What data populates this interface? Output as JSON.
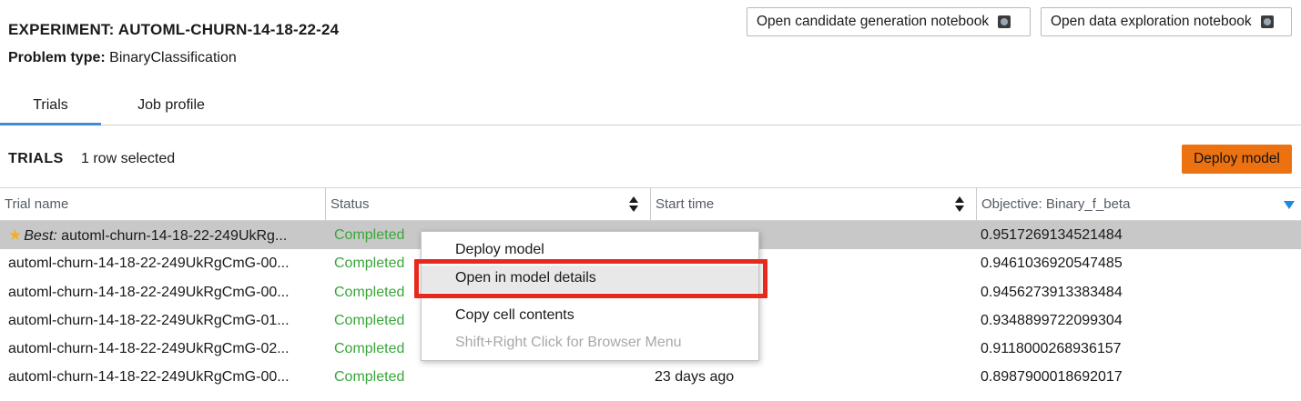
{
  "header": {
    "experiment_label": "EXPERIMENT: AUTOML-CHURN-14-18-22-24",
    "problem_label": "Problem type:",
    "problem_value": "BinaryClassification",
    "candidate_notebook_button": "Open candidate generation notebook",
    "exploration_notebook_button": "Open data exploration notebook",
    "button_icon": "info-icon"
  },
  "tabs": [
    {
      "label": "Trials",
      "active": true
    },
    {
      "label": "Job profile",
      "active": false
    }
  ],
  "trials": {
    "title": "TRIALS",
    "selection_status": "1 row selected",
    "deploy_button": "Deploy model",
    "accent_color": "#ec7211"
  },
  "table": {
    "columns": [
      "Trial name",
      "Status",
      "Start time",
      "Objective: Binary_f_beta"
    ],
    "rows": [
      {
        "best_prefix": "Best:",
        "name": "automl-churn-14-18-22-249UkRg...",
        "status": "Completed",
        "start": "",
        "objective": "0.9517269134521484",
        "selected": true
      },
      {
        "name": "automl-churn-14-18-22-249UkRgCmG-00...",
        "status": "Completed",
        "start": "",
        "objective": "0.9461036920547485"
      },
      {
        "name": "automl-churn-14-18-22-249UkRgCmG-00...",
        "status": "Completed",
        "start": "",
        "objective": "0.9456273913383484"
      },
      {
        "name": "automl-churn-14-18-22-249UkRgCmG-01...",
        "status": "Completed",
        "start": "",
        "objective": "0.9348899722099304"
      },
      {
        "name": "automl-churn-14-18-22-249UkRgCmG-02...",
        "status": "Completed",
        "start": "",
        "objective": "0.9118000268936157"
      },
      {
        "name": "automl-churn-14-18-22-249UkRgCmG-00...",
        "status": "Completed",
        "start": "23 days ago",
        "objective": "0.8987900018692017"
      }
    ],
    "status_color": "#3aa63a"
  },
  "context_menu": {
    "items": [
      "Deploy model",
      "Open in model details",
      "Copy cell contents"
    ],
    "hint": "Shift+Right Click for Browser Menu",
    "highlight_color": "#e8281c"
  }
}
